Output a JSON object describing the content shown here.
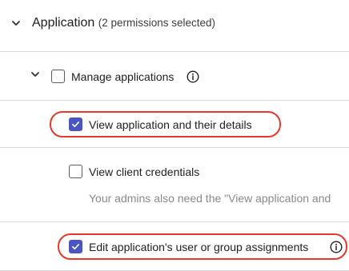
{
  "section": {
    "title": "Application",
    "count_text": "(2 permissions selected)",
    "expand_icon": "chevron-down-icon"
  },
  "group": {
    "label": "Manage applications",
    "checked": false,
    "expand_icon": "chevron-down-icon",
    "info_icon": "info-icon"
  },
  "permissions": [
    {
      "label": "View application and their details",
      "checked": true,
      "highlighted": true
    },
    {
      "label": "View client credentials",
      "checked": false,
      "help_text": "Your admins also need the \"View application and"
    },
    {
      "label": "Edit application's user or group assignments",
      "checked": true,
      "highlighted": true,
      "info_icon": "info-icon"
    }
  ],
  "colors": {
    "checkbox_checked": "#4a55c4",
    "highlight_outline": "#e8372c",
    "divider": "#d9d9d9",
    "help_text": "#8a8a8a"
  }
}
